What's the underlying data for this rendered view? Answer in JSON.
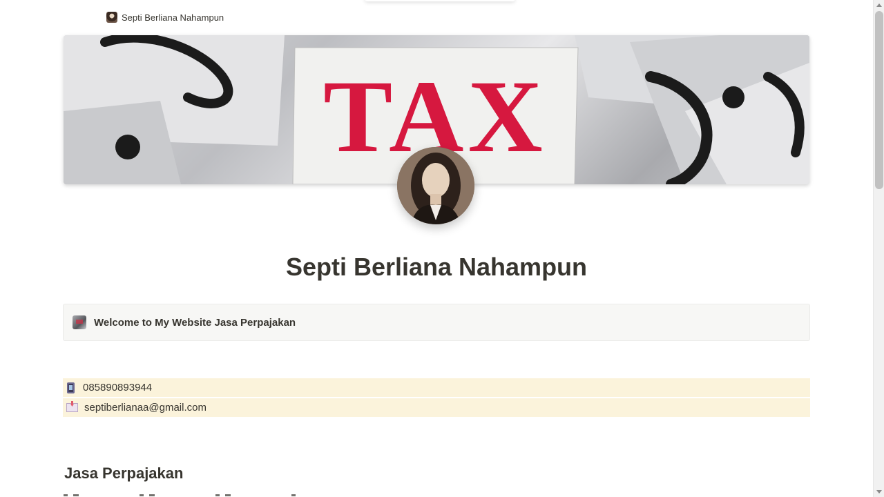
{
  "breadcrumb": {
    "page_title": "Septi Berliana Nahampun"
  },
  "cover": {
    "text": "TAX",
    "text_color": "#d6183f"
  },
  "page": {
    "title": "Septi Berliana Nahampun"
  },
  "callout": {
    "icon": "tax-image-icon",
    "text": "Welcome to My Website Jasa Perpajakan",
    "background": "#f7f7f5"
  },
  "contacts": [
    {
      "icon": "mobile-phone-icon",
      "text": "085890893944"
    },
    {
      "icon": "incoming-envelope-icon",
      "text": "septiberlianaa@gmail.com"
    }
  ],
  "contacts_background": "#fbf3db",
  "section": {
    "heading": "Jasa Perpajakan"
  }
}
